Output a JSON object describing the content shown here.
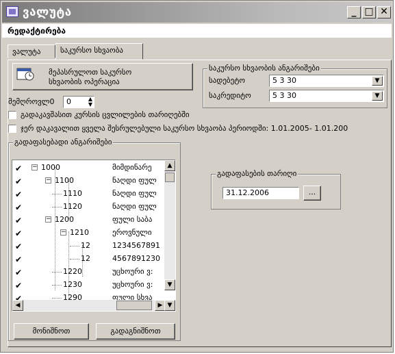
{
  "window": {
    "title": "ვალუტა",
    "minimize": "_",
    "maximize": "□",
    "close": "✕"
  },
  "menu": {
    "item": "რედაქტირება"
  },
  "tabs": [
    {
      "label": "ვალუტა"
    },
    {
      "label": "საკურსო სხვაობა"
    }
  ],
  "compute_button": {
    "label_line1": "მეპასრულოთ საკურსო",
    "label_line2": "სხვაობის ოპერაცია"
  },
  "period": {
    "label": "მემღროვლ0",
    "value": "0"
  },
  "accounts_group": {
    "legend": "საკურსო სხვაობის ანგარიშები",
    "income": {
      "label": "სადებეტო",
      "value": "5 3 30"
    },
    "expense": {
      "label": "საკრედიტო",
      "value": "5 3 30"
    }
  },
  "checkbox1": {
    "label": "გადაკავშასით კურსის ცვლილების თარიღებში"
  },
  "checkbox2": {
    "label": "ჯერ დაკავალით ყველა შესრულებული საკურსო სხვაობა პერიოდში:  1.01.2005- 1.01.200"
  },
  "tree_group": {
    "legend": "გადაფასებადი ანგარიშები"
  },
  "tree_rows": [
    {
      "checked": "✔",
      "code": "1000",
      "expander": "−",
      "name": "მიმდინარე"
    },
    {
      "checked": "✔",
      "code": "1100",
      "expander": "−",
      "name": "ნაღდი ფულ"
    },
    {
      "checked": "✔",
      "code": "1110",
      "expander": "",
      "name": "ნაღდი ფულ"
    },
    {
      "checked": "✔",
      "code": "1120",
      "expander": "",
      "name": "ნაღდი ფულ"
    },
    {
      "checked": "✔",
      "code": "1200",
      "expander": "−",
      "name": "ფული საბა"
    },
    {
      "checked": "✔",
      "code": "1210",
      "expander": "−",
      "name": "ეროვნული"
    },
    {
      "checked": "✔",
      "code": "12",
      "expander": "",
      "name": "1234567891"
    },
    {
      "checked": "✔",
      "code": "12",
      "expander": "",
      "name": "4567891230"
    },
    {
      "checked": "✔",
      "code": "1220",
      "expander": "",
      "name": "უცხოური ვ:"
    },
    {
      "checked": "✔",
      "code": "1230",
      "expander": "",
      "name": "უცხოური ვ:"
    },
    {
      "checked": "✔",
      "code": "1290",
      "expander": "",
      "name": "ფული სხვა"
    }
  ],
  "revaluation_group": {
    "legend": "გადაფასების თარიღი",
    "date": "31.12.2006",
    "browse": "..."
  },
  "bottom_buttons": {
    "select_all": "მონიშნოთ",
    "unselect_all": "გადაგნიშნოთ"
  }
}
